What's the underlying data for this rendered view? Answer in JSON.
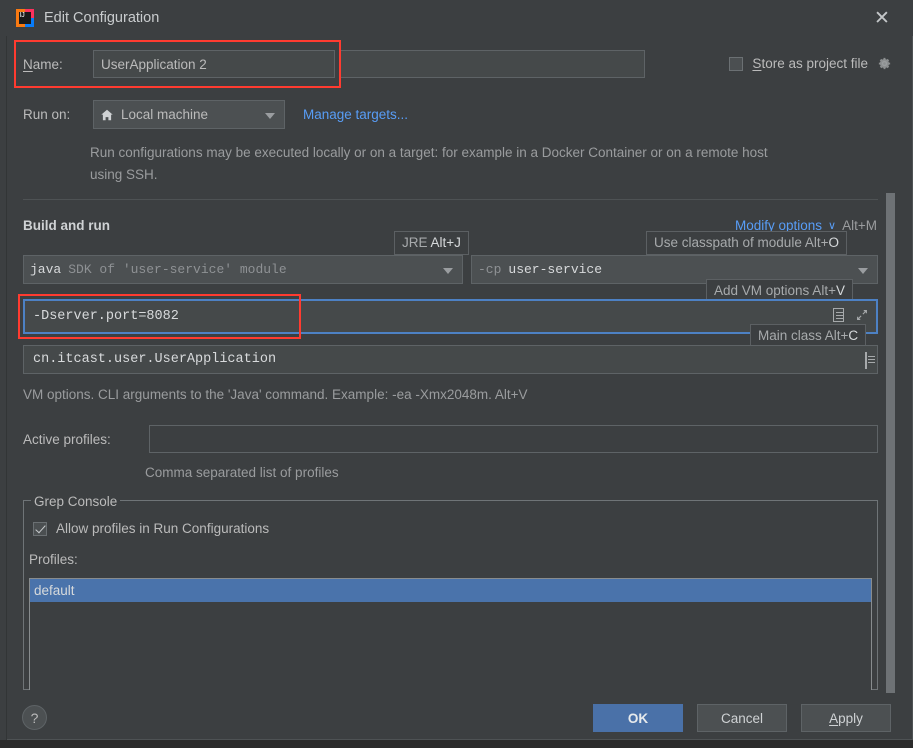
{
  "window": {
    "title": "Edit Configuration",
    "logo_text": "IJ",
    "close_icon": "close-icon"
  },
  "name_row": {
    "label": "Name:",
    "label_mnemonic": "N",
    "value": "UserApplication 2"
  },
  "store_as_project_file": {
    "label": "Store as project file",
    "label_mnemonic": "S",
    "checked": false,
    "gear_icon": "gear-icon"
  },
  "run_on": {
    "label": "Run on:",
    "value": "Local machine",
    "icon": "home-icon",
    "manage_targets_link": "Manage targets..."
  },
  "description": "Run configurations may be executed locally or on a target: for example in a Docker Container or on a remote host using SSH.",
  "build_and_run": {
    "section_title": "Build and run",
    "modify_options": {
      "label": "Modify options",
      "chevron": "∨",
      "shortcut": "Alt+M"
    },
    "jre": {
      "tooltip": "JRE Alt+J",
      "tooltip_text": "JRE ",
      "tooltip_mnemonic": "Alt+J",
      "value_bright": "java",
      "value_dim": "SDK of 'user-service' module"
    },
    "classpath": {
      "tooltip_text": "Use classpath of module Alt+",
      "tooltip_mnemonic": "O",
      "value_dim": "-cp",
      "value_bright": "user-service"
    },
    "vm_options": {
      "tooltip_text": "Add VM options Alt+",
      "tooltip_mnemonic": "V",
      "value": "-Dserver.port=8082",
      "doc_icon": "document-icon",
      "expand_icon": "expand-icon"
    },
    "main_class": {
      "tooltip_text": "Main class Alt+",
      "tooltip_mnemonic": "C",
      "value": "cn.itcast.user.UserApplication",
      "doc_icon": "document-icon"
    },
    "vm_hint": "VM options. CLI arguments to the 'Java' command. Example: -ea -Xmx2048m. Alt+V"
  },
  "active_profiles": {
    "label": "Active profiles:",
    "value": "",
    "hint": "Comma separated list of profiles"
  },
  "grep_console": {
    "group_title": "Grep Console",
    "allow_profiles": {
      "label": "Allow profiles in Run Configurations",
      "checked": true
    },
    "profiles_label": "Profiles:",
    "profiles_items": [
      {
        "label": "default",
        "selected": true
      }
    ]
  },
  "footer": {
    "help_label": "?",
    "ok_label": "OK",
    "cancel_label": "Cancel",
    "apply_label": "Apply",
    "apply_mnemonic": "A"
  },
  "background": {
    "code_left": "· · ·· ···· ·· ···· ·· ···· ····· ···  ··· ····",
    "code_right": "···· ····· ·· ····· ··· ···· ·· ····· ···· ··"
  },
  "colors": {
    "dialog_bg": "#3c3f41",
    "field_bg": "#45494a",
    "accent_blue": "#4a71a8",
    "link_blue": "#589df6",
    "highlight_red": "#ff3b30",
    "selection_blue": "#4a73ab",
    "focus_border": "#4d81c4"
  }
}
